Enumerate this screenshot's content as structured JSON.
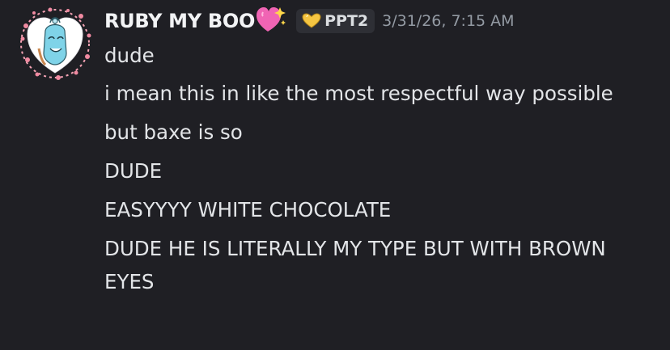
{
  "message_group": {
    "author": {
      "username": "RUBY MY BOO",
      "name_emoji": "sparkling-heart-emoji",
      "tag": "PPT2",
      "tag_icon": "gold-heart-badge-icon",
      "avatar": "avatar-icon"
    },
    "timestamp": "3/31/26, 7:15 AM",
    "messages": [
      "dude",
      "i mean this in like the most respectful way possible",
      "but baxe is so",
      "DUDE",
      "EASYYYY WHITE CHOCOLATE",
      "DUDE HE IS LITERALLY MY TYPE BUT WITH BROWN EYES"
    ]
  },
  "colors": {
    "background": "#1f1f24",
    "username": "#f2f3f5",
    "message_text": "#e3e5e8",
    "timestamp": "#949ba4",
    "tag_background": "#2e2f35",
    "avatar_frame": "#f4a3b4",
    "avatar_character": "#7fd3e8"
  }
}
